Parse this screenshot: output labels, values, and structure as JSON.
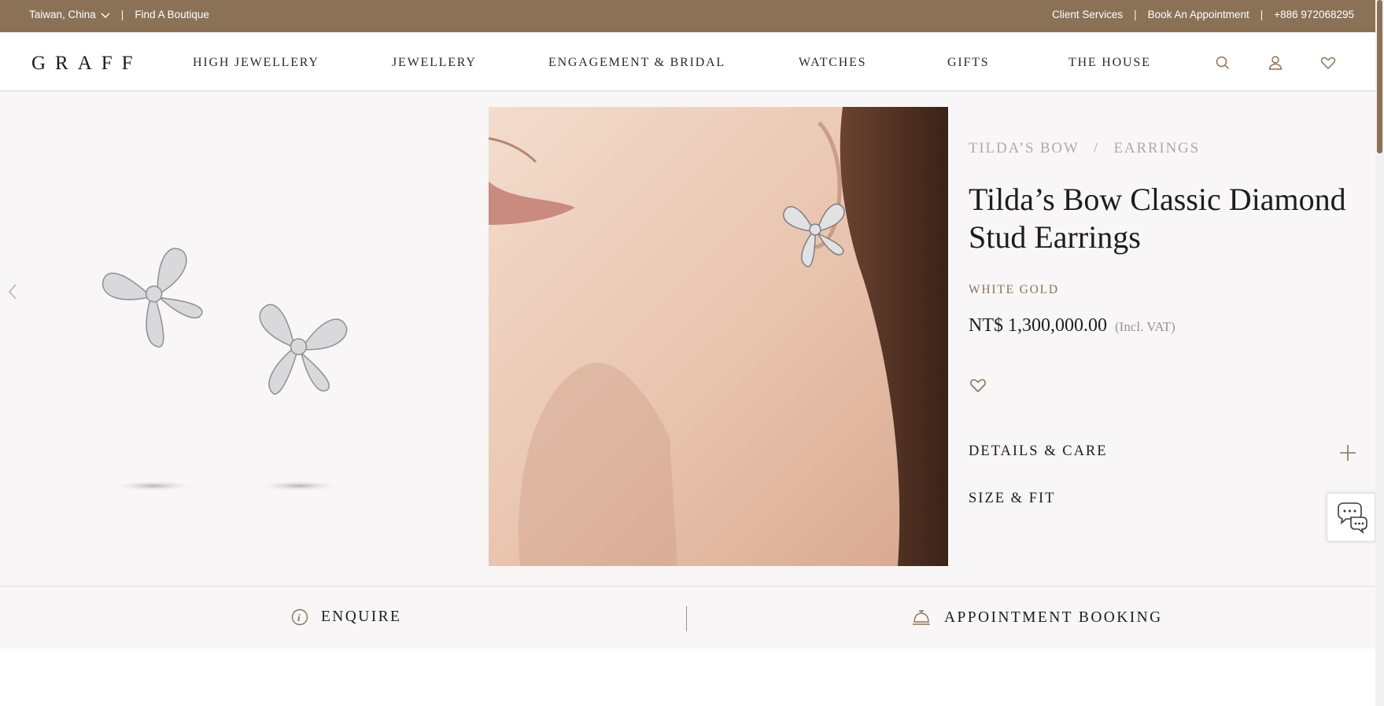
{
  "topbar": {
    "region": "Taiwan, China",
    "find_boutique": "Find A Boutique",
    "client_services": "Client Services",
    "book_appointment": "Book An Appointment",
    "phone": "+886 972068295",
    "bg_color": "#8b7257"
  },
  "nav": {
    "logo": "GRAFF",
    "items": [
      "HIGH JEWELLERY",
      "JEWELLERY",
      "ENGAGEMENT & BRIDAL",
      "WATCHES",
      "GIFTS",
      "THE HOUSE"
    ],
    "icons": [
      "search-icon",
      "account-icon",
      "wishlist-heart-icon"
    ]
  },
  "product": {
    "breadcrumb": [
      "TILDA’S BOW",
      "EARRINGS"
    ],
    "title": "Tilda’s Bow Classic Diamond Stud Earrings",
    "metal": "WHITE GOLD",
    "price": "NT$ 1,300,000.00",
    "vat_note": "(Incl. VAT)",
    "accordions": [
      "DETAILS & CARE",
      "SIZE & FIT"
    ],
    "accent_color": "#8b7257"
  },
  "actions": {
    "enquire": "ENQUIRE",
    "appointment": "APPOINTMENT BOOKING"
  }
}
